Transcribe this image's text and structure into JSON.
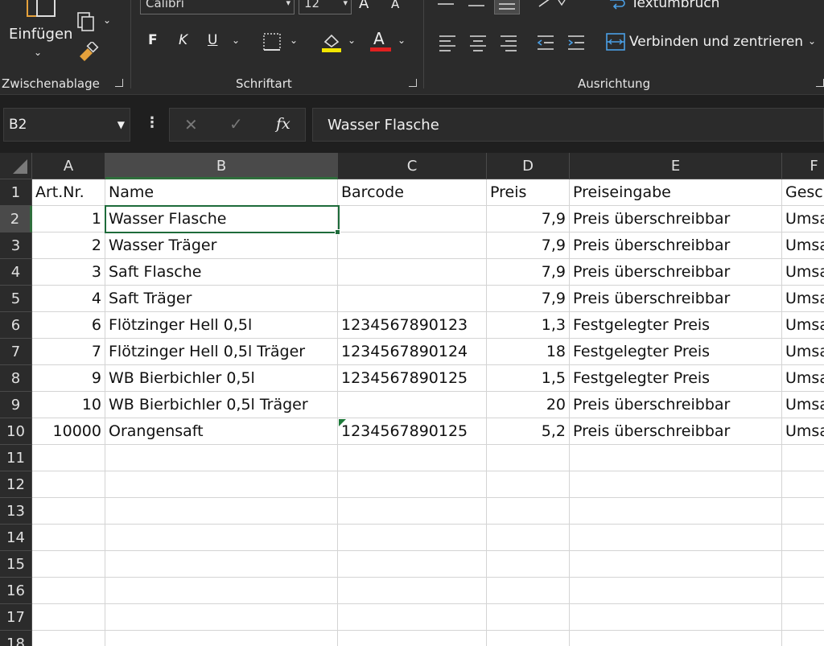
{
  "ribbon": {
    "clipboard": {
      "paste_label": "Einfügen",
      "group_label": "Zwischenablage"
    },
    "font": {
      "font_name": "Calibri",
      "font_size": "12",
      "bold": "F",
      "italic": "K",
      "underline": "U",
      "font_color_letter": "A",
      "group_label": "Schriftart"
    },
    "alignment": {
      "wrap_text_label": "Textumbruch",
      "merge_label": "Verbinden und zentrieren",
      "group_label": "Ausrichtung"
    }
  },
  "formula_bar": {
    "name_box": "B2",
    "fx_label": "fx",
    "value": "Wasser Flasche"
  },
  "columns": [
    "A",
    "B",
    "C",
    "D",
    "E",
    "F"
  ],
  "rows": [
    "1",
    "2",
    "3",
    "4",
    "5",
    "6",
    "7",
    "8",
    "9",
    "10",
    "11",
    "12",
    "13",
    "14",
    "15",
    "16",
    "17",
    "18"
  ],
  "header_row": {
    "a": "Art.Nr.",
    "b": "Name",
    "c": "Barcode",
    "d": "Preis",
    "e": "Preiseingabe",
    "f": "Gesc"
  },
  "data_rows": [
    {
      "a": "1",
      "b": "Wasser Flasche",
      "c": "",
      "d": "7,9",
      "e": "Preis überschreibbar",
      "f": "Umsa"
    },
    {
      "a": "2",
      "b": "Wasser Träger",
      "c": "",
      "d": "7,9",
      "e": "Preis überschreibbar",
      "f": "Umsa"
    },
    {
      "a": "3",
      "b": "Saft Flasche",
      "c": "",
      "d": "7,9",
      "e": "Preis überschreibbar",
      "f": "Umsa"
    },
    {
      "a": "4",
      "b": "Saft Träger",
      "c": "",
      "d": "7,9",
      "e": "Preis überschreibbar",
      "f": "Umsa"
    },
    {
      "a": "6",
      "b": "Flötzinger Hell 0,5l",
      "c": "1234567890123",
      "d": "1,3",
      "e": "Festgelegter Preis",
      "f": "Umsa"
    },
    {
      "a": "7",
      "b": "Flötzinger Hell 0,5l Träger",
      "c": "1234567890124",
      "d": "18",
      "e": "Festgelegter Preis",
      "f": "Umsa"
    },
    {
      "a": "9",
      "b": "WB Bierbichler 0,5l",
      "c": "1234567890125",
      "d": "1,5",
      "e": "Festgelegter Preis",
      "f": "Umsa"
    },
    {
      "a": "10",
      "b": "WB Bierbichler 0,5l Träger",
      "c": "",
      "d": "20",
      "e": "Preis überschreibbar",
      "f": "Umsa"
    },
    {
      "a": "10000",
      "b": "Orangensaft",
      "c": "1234567890125",
      "d": "5,2",
      "e": "Preis überschreibbar",
      "f": "Umsa"
    }
  ],
  "colors": {
    "accent": "#1e6b3a",
    "ribbon_bg": "#2b2b2b",
    "underline_yellow": "#f2e600",
    "font_red": "#e02020"
  }
}
